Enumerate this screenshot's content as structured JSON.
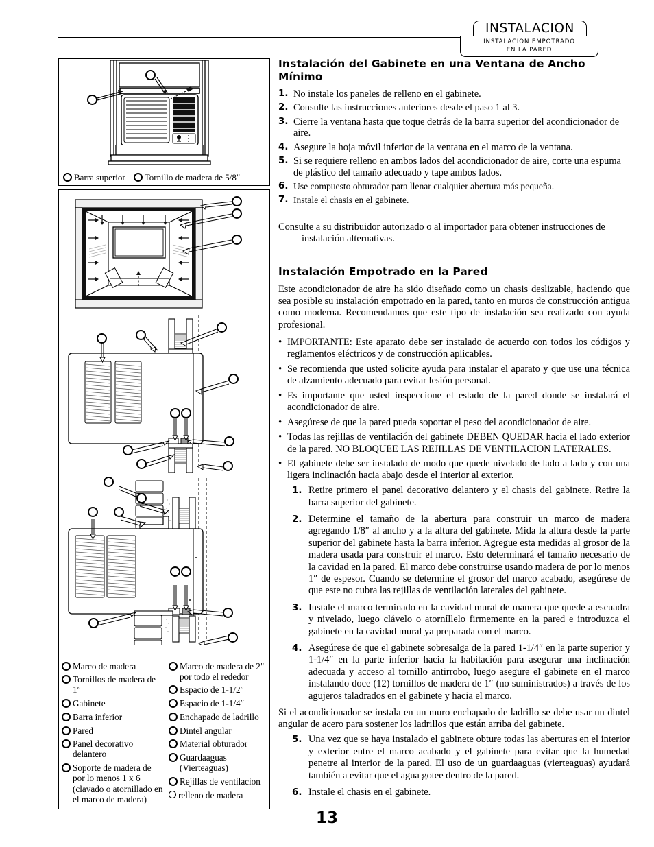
{
  "header": {
    "title": "INSTALACION",
    "subtitle_line1": "INSTALACION EMPOTRADO",
    "subtitle_line2": "EN LA PARED"
  },
  "page_number": "13",
  "section1": {
    "heading": "Instalación del Gabinete en una Ventana de Ancho Mínimo",
    "steps": [
      {
        "n": "1.",
        "text": "No instale los paneles de relleno en el gabinete."
      },
      {
        "n": "2.",
        "text": "Consulte las instrucciones anteriores desde el paso 1 al 3."
      },
      {
        "n": "3.",
        "text": "Cierre la ventana hasta que toque detrás de la barra superior del acondicionador de aire."
      },
      {
        "n": "4.",
        "text": "Asegure la hoja móvil inferior de la ventana en el marco de la ventana."
      },
      {
        "n": "5.",
        "text": "Si se requiere relleno en ambos lados del acondicionador de aire, corte una espuma de plástico del tamaño adecuado y tape ambos lados."
      },
      {
        "n": "6.",
        "text": "Use compuesto obturador para llenar cualquier abertura más pequeña."
      },
      {
        "n": "7.",
        "text": "Instale el chasis en el gabinete."
      }
    ],
    "closing": "Consulte a su distribuidor autorizado o al importador para obtener instrucciones de instalación alternativas."
  },
  "section2": {
    "heading": "Instalación Empotrado en la Pared",
    "intro": "Este acondicionador de aire ha sido diseñado como un chasis deslizable, haciendo que sea posible su instalación empotrado en la pared, tanto en muros de construcción antigua como moderna.  Recomendamos que este tipo de instalación sea realizado con ayuda profesional.",
    "bullets": [
      "IMPORTANTE: Este aparato debe ser instalado de acuerdo con todos los códigos y reglamentos eléctricos y de construcción aplicables.",
      "Se recomienda que usted solicite ayuda para instalar el aparato y que use una técnica de alzamiento adecuado para evitar lesión personal.",
      "Es importante que usted inspeccione el estado de la pared donde se instalará el acondicionador de aire.",
      "Asegúrese de que la pared pueda soportar el peso del acondicionador de aire.",
      "Todas las rejillas de ventilación del gabinete DEBEN QUEDAR hacia el lado exterior de la pared.   NO BLOQUEE LAS REJILLAS DE VENTILACION LATERALES.",
      "El gabinete debe ser instalado de modo que quede nivelado de lado a lado y con una ligera inclinación hacia abajo desde el interior al exterior."
    ],
    "steps_a": [
      {
        "n": "1.",
        "text": "Retire primero el panel decorativo delantero y el chasis del gabinete.  Retire la barra superior del gabinete."
      },
      {
        "n": "2.",
        "text": "Determine el tamaño de la abertura para construir un marco de madera agregando 1/8″ al ancho y a la altura del gabinete.  Mida la altura desde la parte superior del gabinete hasta la barra inferior.  Agregue esta medidas al grosor de la madera usada para construir el marco.  Esto determinará el tamaño necesario de la cavidad en la pared.  El marco debe construirse usando madera de por lo menos 1″ de espesor.  Cuando se determine el grosor del marco acabado, asegúrese de que este no cubra las rejillas de ventilación laterales del gabinete."
      },
      {
        "n": "3.",
        "text": "Instale el marco terminado en la cavidad mural de manera que quede a escuadra y nivelado, luego clávelo o atorníllelo firmemente en la pared e introduzca el gabinete en la cavidad mural ya preparada con el marco."
      },
      {
        "n": "4.",
        "text": "Asegúrese de que el gabinete sobresalga de la pared 1-1/4″ en la parte superior y 1-1/4″ en la parte inferior hacia la habitación para asegurar una inclinación adecuada y acceso al tornillo antirrobo, luego asegure el gabinete en el marco instalando doce (12) tornillos de madera de 1″ (no suministrados) a través de los agujeros taladrados en el gabinete y hacia el marco."
      }
    ],
    "mid_paragraph": "Si el acondicionador se instala en un muro enchapado de ladrillo se debe usar un dintel angular de acero para sostener los ladrillos que están arriba del gabinete.",
    "steps_b": [
      {
        "n": "5.",
        "text": "Una vez que se haya instalado el gabinete obture todas las aberturas en el interior y exterior entre el marco acabado y el gabinete para evitar que la humedad penetre al interior de la pared.  El uso de un guardaaguas (vierteaguas) ayudará también a evitar que el agua gotee dentro de la pared."
      },
      {
        "n": "6.",
        "text": "Instale el chasis en el gabinete."
      }
    ]
  },
  "figure_top": {
    "legend": [
      {
        "label": "Barra superior"
      },
      {
        "label": "Tornillo de madera de 5/8″"
      }
    ]
  },
  "figure_bottom": {
    "legend_col_a": [
      {
        "label": "Marco de madera"
      },
      {
        "label": "Tornillos de madera de 1″"
      },
      {
        "label": "Gabinete"
      },
      {
        "label": "Barra inferior"
      },
      {
        "label": "Pared"
      },
      {
        "label": "Panel decorativo delantero"
      },
      {
        "label": "Soporte de madera de por lo menos 1 x 6 (clavado o atornillado en el marco de madera)"
      }
    ],
    "legend_col_b": [
      {
        "label": "Marco de madera de 2\" por todo el rededor"
      },
      {
        "label": "Espacio de 1-1/2″"
      },
      {
        "label": "Espacio de 1-1/4″"
      },
      {
        "label": "Enchapado de ladrillo"
      },
      {
        "label": "Dintel angular"
      },
      {
        "label": "Material obturador"
      },
      {
        "label": "Guardaaguas (Vierteaguas)"
      },
      {
        "label": "Rejillas de ventilacion"
      },
      {
        "label": "relleno de madera"
      }
    ]
  }
}
